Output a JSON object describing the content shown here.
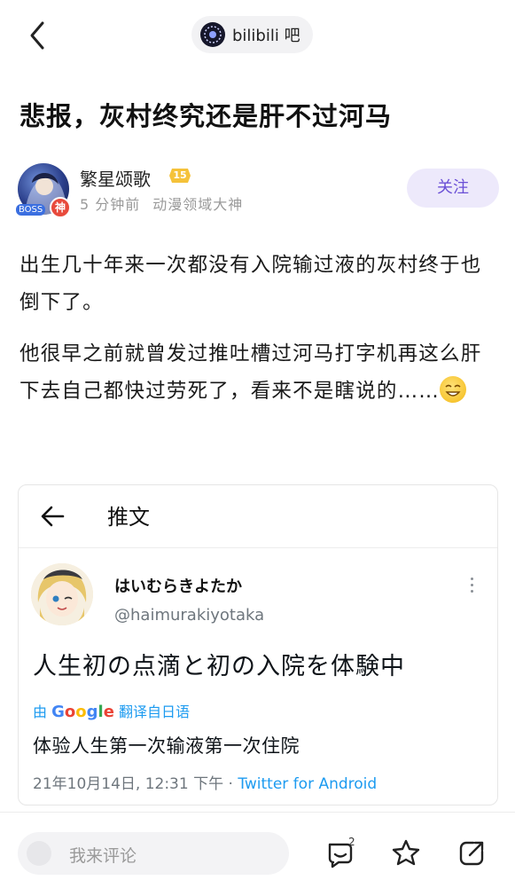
{
  "header": {
    "forum_name": "bilibili 吧"
  },
  "post": {
    "title": "悲报，灰村终究还是肝不过河马",
    "author": {
      "name": "繁星颂歌",
      "level": "15",
      "time": "5 分钟前",
      "role": "动漫领域大神",
      "badge_left": "BOSS",
      "badge_god": "神"
    },
    "follow_label": "关注",
    "paragraph1": "出生几十年来一次都没有入院输过液的灰村终于也倒下了。",
    "paragraph2": "他很早之前就曾发过推吐槽过河马打字机再这么肝下去自己都快过劳死了，看来不是瞎说的……"
  },
  "tweet": {
    "header_title": "推文",
    "display_name": "はいむらきよたか",
    "handle": "@haimurakiyotaka",
    "text": "人生初の点滴と初の入院を体験中",
    "translate_prefix": "由",
    "translate_brand": "Google",
    "translate_suffix": "翻译自日语",
    "translated_text": "体验人生第一次输液第一次住院",
    "timestamp": "21年10月14日, 12:31 下午 · ",
    "source": "Twitter for Android"
  },
  "bottom_bar": {
    "comment_placeholder": "我来评论",
    "comment_count": "2"
  },
  "colors": {
    "accent": "#6a4fd6",
    "follow_bg": "#ede9fb",
    "twitter_blue": "#1d9bf0"
  }
}
